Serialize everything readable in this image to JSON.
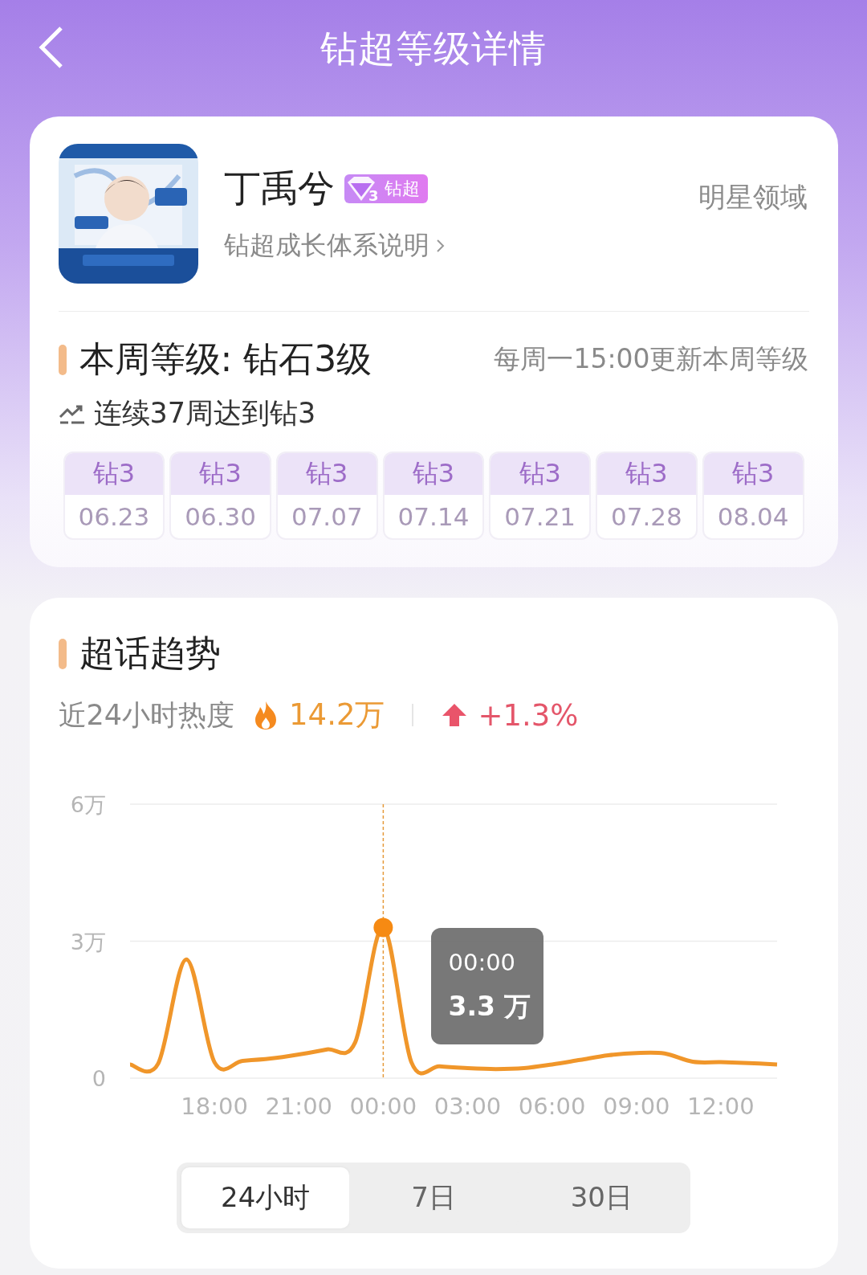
{
  "header": {
    "title": "钻超等级详情"
  },
  "profile": {
    "name": "丁禹兮",
    "badge": {
      "level": "3",
      "label": "钻超"
    },
    "link": "钻超成长体系说明",
    "domain": "明星领域"
  },
  "level": {
    "title": "本周等级: 钻石3级",
    "update_note": "每周一15:00更新本周等级",
    "streak": "连续37周达到钻3",
    "weeks": [
      {
        "level": "钻3",
        "date": "06.23"
      },
      {
        "level": "钻3",
        "date": "06.30"
      },
      {
        "level": "钻3",
        "date": "07.07"
      },
      {
        "level": "钻3",
        "date": "07.14"
      },
      {
        "level": "钻3",
        "date": "07.21"
      },
      {
        "level": "钻3",
        "date": "07.28"
      },
      {
        "level": "钻3",
        "date": "08.04"
      }
    ]
  },
  "trend": {
    "title": "超话趋势",
    "heat_label": "近24小时热度",
    "heat_value": "14.2万",
    "change": "+1.3%",
    "chart_data": {
      "type": "line",
      "categories": [
        null,
        null,
        null,
        "18:00",
        null,
        null,
        "21:00",
        null,
        null,
        "00:00",
        null,
        null,
        "03:00",
        null,
        null,
        "06:00",
        null,
        null,
        "09:00",
        null,
        null,
        "12:00",
        null,
        null
      ],
      "series": [
        {
          "color": "#f0962a",
          "values": [
            0.3,
            0.32,
            2.6,
            0.35,
            0.38,
            0.43,
            0.52,
            0.63,
            0.78,
            3.3,
            0.35,
            0.26,
            0.22,
            0.2,
            0.22,
            0.3,
            0.4,
            0.5,
            0.55,
            0.54,
            0.36,
            0.35,
            0.33,
            0.3
          ]
        }
      ],
      "ylim": [
        0,
        6
      ],
      "yticks": [
        0,
        {
          "value": 3,
          "label": "3万"
        },
        {
          "value": 6,
          "label": "6万"
        }
      ],
      "ref_lines": [
        {
          "axis": "y",
          "value": 3
        }
      ]
    },
    "tooltip": {
      "time": "00:00",
      "value": "3.3 万"
    },
    "ranges": [
      {
        "label": "24小时",
        "selected": true
      },
      {
        "label": "7日",
        "selected": false
      },
      {
        "label": "30日",
        "selected": false
      }
    ]
  }
}
